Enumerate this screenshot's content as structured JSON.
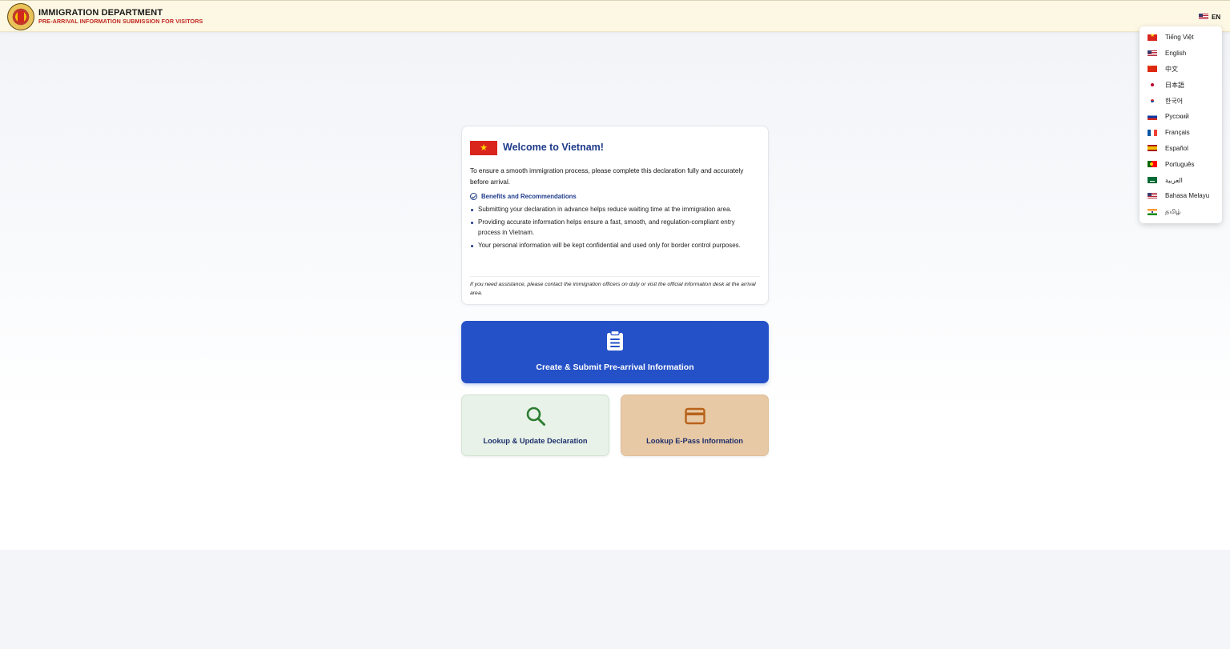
{
  "header": {
    "title": "IMMIGRATION DEPARTMENT",
    "subtitle": "PRE-ARRIVAL INFORMATION SUBMISSION FOR VISITORS",
    "language_code": "EN"
  },
  "language_menu": {
    "items": [
      {
        "label": "Tiếng Việt",
        "flag": "vn"
      },
      {
        "label": "English",
        "flag": "us"
      },
      {
        "label": "中文",
        "flag": "cn"
      },
      {
        "label": "日本語",
        "flag": "jp"
      },
      {
        "label": "한국어",
        "flag": "kr"
      },
      {
        "label": "Русский",
        "flag": "ru"
      },
      {
        "label": "Français",
        "flag": "fr"
      },
      {
        "label": "Español",
        "flag": "es"
      },
      {
        "label": "Português",
        "flag": "pt"
      },
      {
        "label": "العربية",
        "flag": "sa"
      },
      {
        "label": "Bahasa Melayu",
        "flag": "us"
      },
      {
        "label": "தமிழ்",
        "flag": "in"
      }
    ]
  },
  "welcome": {
    "title": "Welcome to Vietnam!",
    "intro": "To ensure a smooth immigration process, please complete this declaration fully and accurately before arrival.",
    "benefits_title": "Benefits and Recommendations",
    "benefits": [
      "Submitting your declaration in advance helps reduce waiting time at the immigration area.",
      "Providing accurate information helps ensure a fast, smooth, and regulation-compliant entry process in Vietnam.",
      "Your personal information will be kept confidential and used only for border control purposes."
    ],
    "assistance": "If you need assistance, please contact the immigration officers on duty or visit the official information desk at the arrival area."
  },
  "actions": {
    "create_label": "Create & Submit Pre-arrival Information",
    "lookup_label": "Lookup & Update Declaration",
    "epass_label": "Lookup E-Pass Information"
  },
  "colors": {
    "header_bg": "#fdf8e4",
    "primary_blue": "#2451c7",
    "title_navy": "#1e3a8a",
    "lookup_bg": "#e8f2e8",
    "lookup_icon": "#2e7d32",
    "epass_bg": "#e8c9a5",
    "epass_icon": "#b8621b",
    "subtitle_red": "#c0261f"
  },
  "icons": {
    "emblem": "national-emblem",
    "create": "clipboard-icon",
    "lookup": "search-icon",
    "epass": "credit-card-icon",
    "benefits": "check-circle-icon"
  }
}
